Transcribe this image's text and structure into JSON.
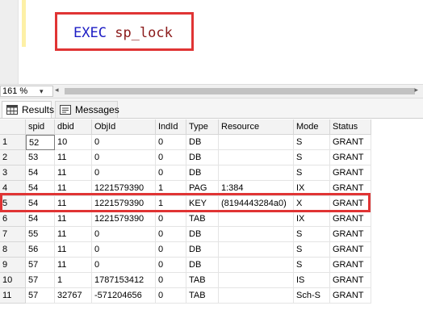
{
  "editor": {
    "keyword": "EXEC",
    "procedure": "sp_lock"
  },
  "zoom": {
    "value": "161 %"
  },
  "tabs": [
    {
      "label": "Results",
      "icon": "grid-icon",
      "active": true
    },
    {
      "label": "Messages",
      "icon": "messages-icon",
      "active": false
    }
  ],
  "grid": {
    "columns": [
      "",
      "spid",
      "dbid",
      "ObjId",
      "IndId",
      "Type",
      "Resource",
      "Mode",
      "Status"
    ],
    "rows": [
      [
        "1",
        "52",
        "10",
        "0",
        "0",
        "DB",
        "",
        "S",
        "GRANT"
      ],
      [
        "2",
        "53",
        "11",
        "0",
        "0",
        "DB",
        "",
        "S",
        "GRANT"
      ],
      [
        "3",
        "54",
        "11",
        "0",
        "0",
        "DB",
        "",
        "S",
        "GRANT"
      ],
      [
        "4",
        "54",
        "11",
        "1221579390",
        "1",
        "PAG",
        "1:384",
        "IX",
        "GRANT"
      ],
      [
        "5",
        "54",
        "11",
        "1221579390",
        "1",
        "KEY",
        "(8194443284a0)",
        "X",
        "GRANT"
      ],
      [
        "6",
        "54",
        "11",
        "1221579390",
        "0",
        "TAB",
        "",
        "IX",
        "GRANT"
      ],
      [
        "7",
        "55",
        "11",
        "0",
        "0",
        "DB",
        "",
        "S",
        "GRANT"
      ],
      [
        "8",
        "56",
        "11",
        "0",
        "0",
        "DB",
        "",
        "S",
        "GRANT"
      ],
      [
        "9",
        "57",
        "11",
        "0",
        "0",
        "DB",
        "",
        "S",
        "GRANT"
      ],
      [
        "10",
        "57",
        "1",
        "1787153412",
        "0",
        "TAB",
        "",
        "IS",
        "GRANT"
      ],
      [
        "11",
        "57",
        "32767",
        "-571204656",
        "0",
        "TAB",
        "",
        "Sch-S",
        "GRANT"
      ]
    ]
  },
  "colors": {
    "highlight": "#e03434",
    "keyword": "#1c1cc4",
    "procedure": "#8b1a1a"
  }
}
